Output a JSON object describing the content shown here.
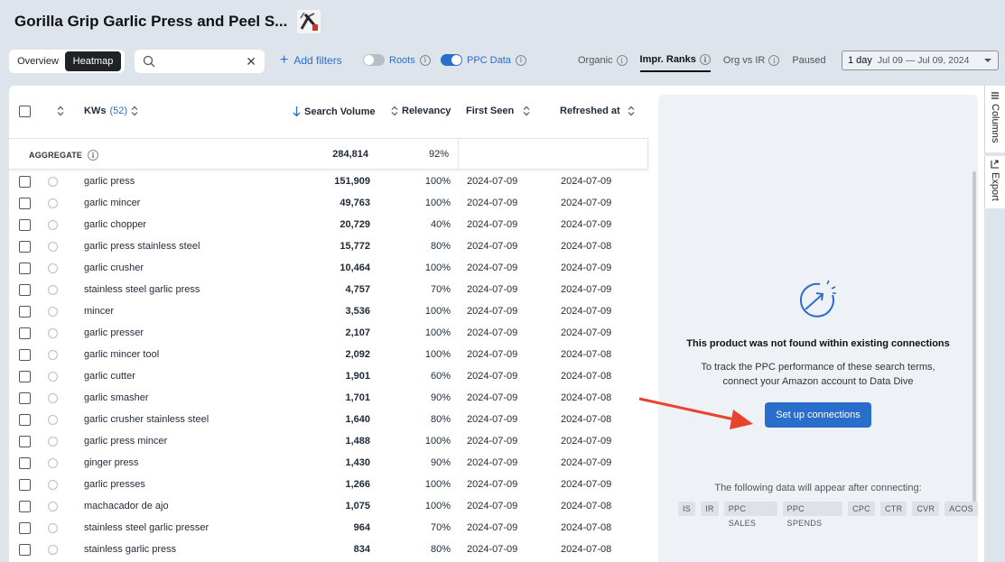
{
  "header": {
    "title": "Gorilla Grip Garlic Press and Peel S..."
  },
  "toolbar": {
    "overview_label": "Overview",
    "heatmap_label": "Heatmap",
    "search": {
      "value": "",
      "placeholder": ""
    },
    "add_filters_label": "Add filters",
    "roots_label": "Roots",
    "ppc_data_label": "PPC Data",
    "tabs": [
      {
        "label": "Organic",
        "info": true
      },
      {
        "label": "Impr. Ranks",
        "info": true,
        "active": true
      },
      {
        "label": "Org vs IR",
        "info": true
      },
      {
        "label": "Paused",
        "info": false
      }
    ],
    "date_range": {
      "label": "1 day",
      "dates": "Jul 09 — Jul 09, 2024"
    }
  },
  "table": {
    "columns": {
      "kws": "KWs",
      "kws_count": "(52)",
      "search_volume": "Search Volume",
      "relevancy": "Relevancy",
      "first_seen": "First Seen",
      "refreshed_at": "Refreshed at"
    },
    "aggregate": {
      "label": "AGGREGATE",
      "search_volume": "284,814",
      "relevancy": "92%"
    },
    "rows": [
      {
        "kw": "garlic press",
        "sv": "151,909",
        "rel": "100%",
        "first": "2024-07-09",
        "refreshed": "2024-07-09"
      },
      {
        "kw": "garlic mincer",
        "sv": "49,763",
        "rel": "100%",
        "first": "2024-07-09",
        "refreshed": "2024-07-09"
      },
      {
        "kw": "garlic chopper",
        "sv": "20,729",
        "rel": "40%",
        "first": "2024-07-09",
        "refreshed": "2024-07-09"
      },
      {
        "kw": "garlic press stainless steel",
        "sv": "15,772",
        "rel": "80%",
        "first": "2024-07-09",
        "refreshed": "2024-07-08"
      },
      {
        "kw": "garlic crusher",
        "sv": "10,464",
        "rel": "100%",
        "first": "2024-07-09",
        "refreshed": "2024-07-09"
      },
      {
        "kw": "stainless steel garlic press",
        "sv": "4,757",
        "rel": "70%",
        "first": "2024-07-09",
        "refreshed": "2024-07-09"
      },
      {
        "kw": "mincer",
        "sv": "3,536",
        "rel": "100%",
        "first": "2024-07-09",
        "refreshed": "2024-07-09"
      },
      {
        "kw": "garlic presser",
        "sv": "2,107",
        "rel": "100%",
        "first": "2024-07-09",
        "refreshed": "2024-07-09"
      },
      {
        "kw": "garlic mincer tool",
        "sv": "2,092",
        "rel": "100%",
        "first": "2024-07-09",
        "refreshed": "2024-07-08"
      },
      {
        "kw": "garlic cutter",
        "sv": "1,901",
        "rel": "60%",
        "first": "2024-07-09",
        "refreshed": "2024-07-08"
      },
      {
        "kw": "garlic smasher",
        "sv": "1,701",
        "rel": "90%",
        "first": "2024-07-09",
        "refreshed": "2024-07-08"
      },
      {
        "kw": "garlic crusher stainless steel",
        "sv": "1,640",
        "rel": "80%",
        "first": "2024-07-09",
        "refreshed": "2024-07-08"
      },
      {
        "kw": "garlic press mincer",
        "sv": "1,488",
        "rel": "100%",
        "first": "2024-07-09",
        "refreshed": "2024-07-09"
      },
      {
        "kw": "ginger press",
        "sv": "1,430",
        "rel": "90%",
        "first": "2024-07-09",
        "refreshed": "2024-07-09"
      },
      {
        "kw": "garlic presses",
        "sv": "1,266",
        "rel": "100%",
        "first": "2024-07-09",
        "refreshed": "2024-07-09"
      },
      {
        "kw": "machacador de ajo",
        "sv": "1,075",
        "rel": "100%",
        "first": "2024-07-09",
        "refreshed": "2024-07-08"
      },
      {
        "kw": "stainless steel garlic presser",
        "sv": "964",
        "rel": "70%",
        "first": "2024-07-09",
        "refreshed": "2024-07-08"
      },
      {
        "kw": "stainless garlic press",
        "sv": "834",
        "rel": "80%",
        "first": "2024-07-09",
        "refreshed": "2024-07-08"
      }
    ]
  },
  "ppc_panel": {
    "title": "This product was not found within existing connections",
    "description": "To track the PPC performance of these search terms, connect your Amazon account to Data Dive",
    "button_label": "Set up connections",
    "after_text": "The following data will appear after connecting:",
    "chips": [
      "IS",
      "IR",
      "PPC SALES",
      "PPC SPENDS",
      "CPC",
      "CTR",
      "CVR",
      "ACOS"
    ]
  },
  "side_tabs": {
    "columns_label": "Columns",
    "export_label": "Export"
  },
  "colors": {
    "accent": "#2a6ecb",
    "background": "#dde4ec",
    "annotation_arrow": "#e8432c"
  }
}
